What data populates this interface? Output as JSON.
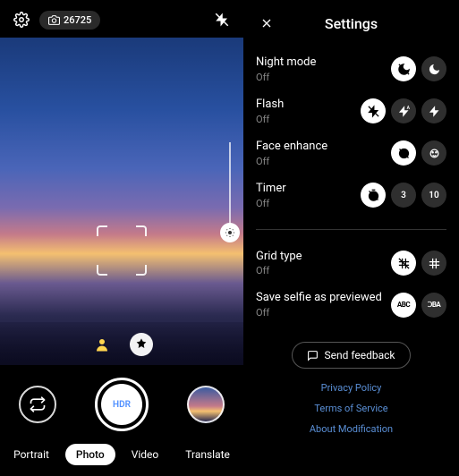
{
  "topbar": {
    "shot_count": "26725"
  },
  "shutter_label": "HDR",
  "modes": [
    "Portrait",
    "Photo",
    "Video",
    "Translate"
  ],
  "active_mode": 1,
  "settings_title": "Settings",
  "rows": {
    "night": {
      "label": "Night mode",
      "value": "Off"
    },
    "flash": {
      "label": "Flash",
      "value": "Off"
    },
    "face": {
      "label": "Face enhance",
      "value": "Off"
    },
    "timer": {
      "label": "Timer",
      "value": "Off",
      "opts": [
        "3",
        "10"
      ]
    },
    "grid": {
      "label": "Grid type",
      "value": "Off"
    },
    "selfie": {
      "label": "Save selfie as previewed",
      "value": "Off",
      "opts": [
        "ABC",
        "ↃBA"
      ]
    }
  },
  "feedback": "Send feedback",
  "links": [
    "Privacy Policy",
    "Terms of Service",
    "About Modification"
  ]
}
